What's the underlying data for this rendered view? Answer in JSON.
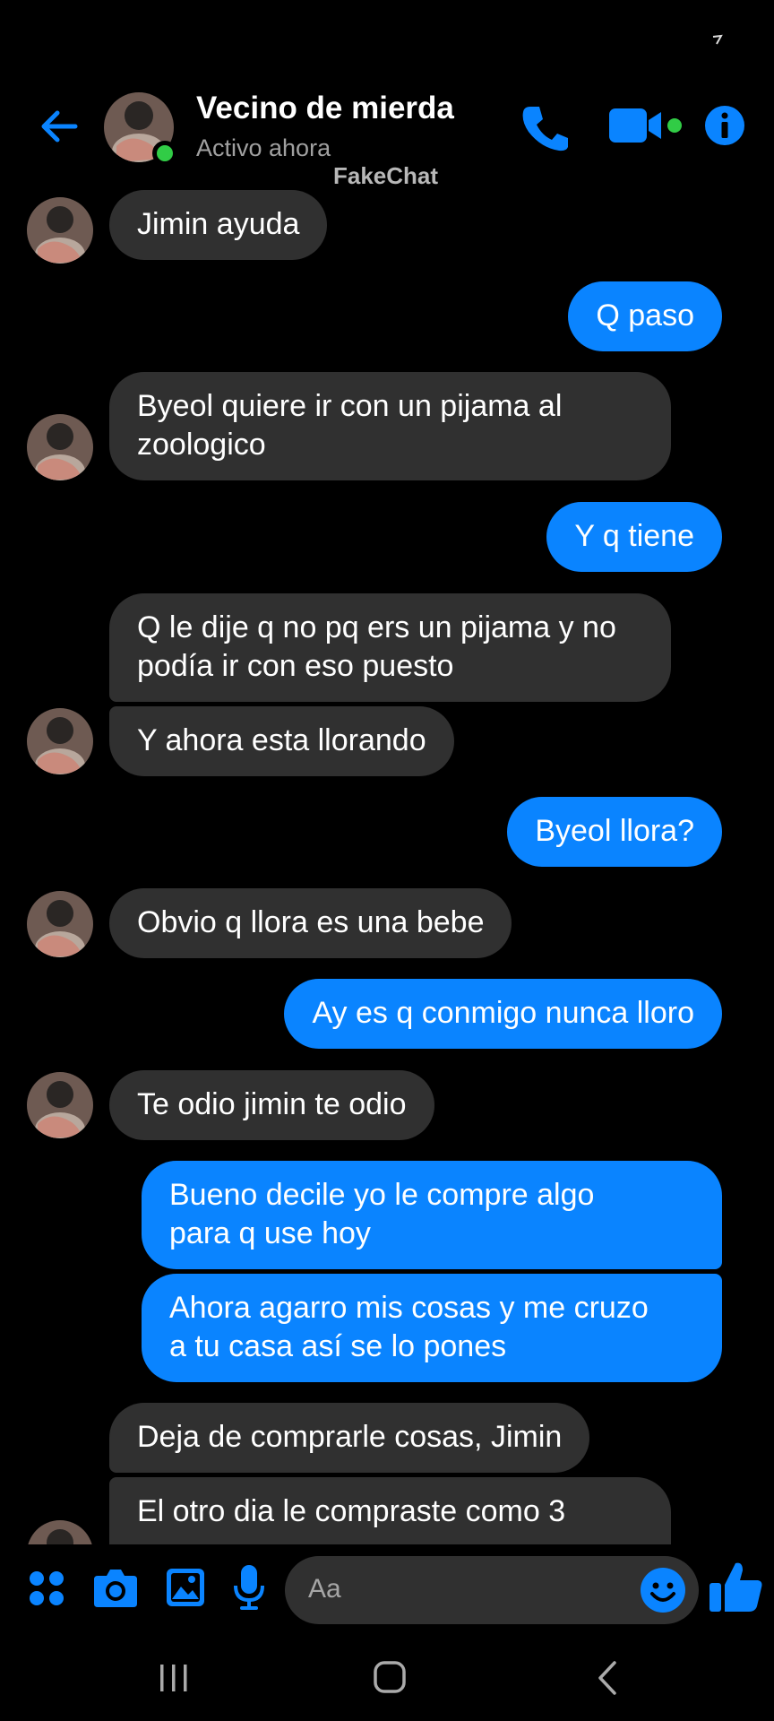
{
  "header": {
    "contact_name": "Vecino de mierda",
    "contact_status": "Activo ahora",
    "back_icon": "arrow-left-icon",
    "call_icon": "phone-icon",
    "video_icon": "video-camera-icon",
    "info_icon": "info-icon"
  },
  "watermark": "FakeChat",
  "messages": [
    {
      "from": "contact",
      "text": "Jimin ayuda"
    },
    {
      "from": "me",
      "text": "Q paso"
    },
    {
      "from": "contact",
      "lines": [
        "Byeol quiere ir con un pijama al",
        "zoologico"
      ]
    },
    {
      "from": "me",
      "text": "Y q tiene"
    },
    {
      "from": "contact",
      "lines": [
        "Q le dije q no pq ers un pijama y no",
        "podía ir con eso puesto"
      ]
    },
    {
      "from": "contact",
      "text": "Y ahora esta llorando"
    },
    {
      "from": "me",
      "text": "Byeol llora?"
    },
    {
      "from": "contact",
      "text": "Obvio q llora es una bebe"
    },
    {
      "from": "me",
      "text": "Ay es q conmigo nunca lloro"
    },
    {
      "from": "contact",
      "text": "Te odio jimin te odio"
    },
    {
      "from": "me",
      "lines": [
        "Bueno decile yo le compre algo",
        "para q use hoy"
      ]
    },
    {
      "from": "me",
      "lines": [
        "Ahora agarro mis cosas y me cruzo",
        "a tu casa así se lo pones"
      ]
    },
    {
      "from": "contact",
      "text": "Deja de comprarle cosas, Jimin"
    },
    {
      "from": "contact",
      "lines": [
        "El otro dia le compraste como 3",
        ""
      ]
    }
  ],
  "composer": {
    "placeholder": "Aa",
    "icons": [
      "apps-icon",
      "camera-icon",
      "image-icon",
      "microphone-icon",
      "emoji-icon",
      "thumbs-up-icon"
    ]
  },
  "navbar": {
    "icons": [
      "recents-icon",
      "home-icon",
      "back-icon"
    ]
  },
  "colors": {
    "accent": "#0a84ff",
    "incoming_bubble": "#303030",
    "online": "#31cc46",
    "background": "#000000"
  }
}
